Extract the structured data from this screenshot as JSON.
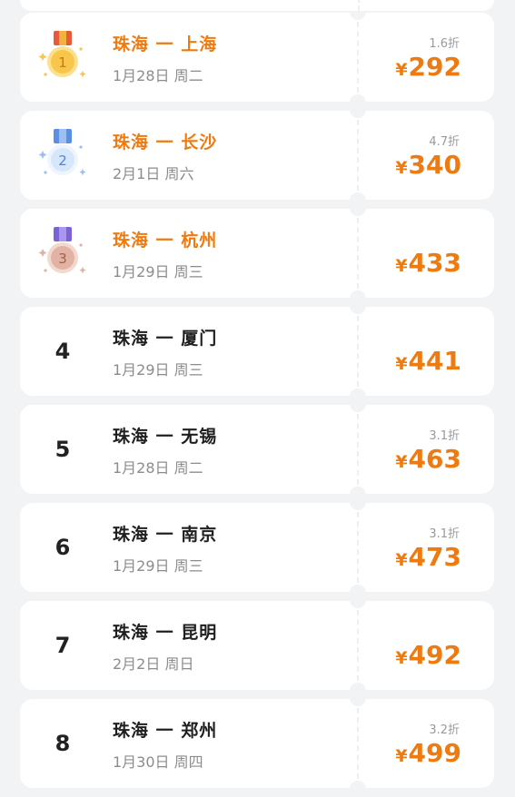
{
  "routes": [
    {
      "rank": "1",
      "route": "珠海 一 上海",
      "date": "1月28日 周二",
      "discount": "1.6折",
      "currency": "¥",
      "price": "292",
      "medal": "gold-medal-icon"
    },
    {
      "rank": "2",
      "route": "珠海 一 长沙",
      "date": "2月1日 周六",
      "discount": "4.7折",
      "currency": "¥",
      "price": "340",
      "medal": "silver-medal-icon"
    },
    {
      "rank": "3",
      "route": "珠海 一 杭州",
      "date": "1月29日 周三",
      "discount": "",
      "currency": "¥",
      "price": "433",
      "medal": "bronze-medal-icon"
    },
    {
      "rank": "4",
      "route": "珠海 一 厦门",
      "date": "1月29日 周三",
      "discount": "",
      "currency": "¥",
      "price": "441"
    },
    {
      "rank": "5",
      "route": "珠海 一 无锡",
      "date": "1月28日 周二",
      "discount": "3.1折",
      "currency": "¥",
      "price": "463"
    },
    {
      "rank": "6",
      "route": "珠海 一 南京",
      "date": "1月29日 周三",
      "discount": "3.1折",
      "currency": "¥",
      "price": "473"
    },
    {
      "rank": "7",
      "route": "珠海 一 昆明",
      "date": "2月2日 周日",
      "discount": "",
      "currency": "¥",
      "price": "492"
    },
    {
      "rank": "8",
      "route": "珠海 一 郑州",
      "date": "1月30日 周四",
      "discount": "3.2折",
      "currency": "¥",
      "price": "499"
    }
  ],
  "colors": {
    "accent": "#ee7b12",
    "gold": "#f5a623",
    "silver": "#8fb8ee",
    "bronze": "#d59a88"
  }
}
